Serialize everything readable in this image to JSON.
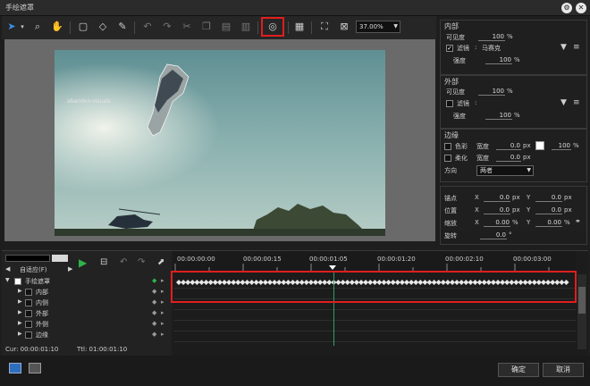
{
  "window": {
    "title": "手绘遮罩"
  },
  "toolbar": {
    "icons": [
      "arrow-cursor-icon",
      "zoom-icon",
      "hand-icon",
      "rectangle-icon",
      "ellipse-icon",
      "pen-icon",
      "undo-icon",
      "redo-icon",
      "cut-icon",
      "copy-icon",
      "paste-icon",
      "delete-icon",
      "track-object-icon",
      "grid-icon",
      "fit-icon",
      "fullscreen-icon"
    ],
    "zoom": "37.00%"
  },
  "preview": {
    "watermark": "abandon-visuals"
  },
  "inner": {
    "title": "内部",
    "visibility_label": "可见度",
    "visibility": "100",
    "filter_label": "滤镜",
    "filter_value": "马赛克",
    "strength_label": "强度",
    "strength": "100"
  },
  "outer": {
    "title": "外部",
    "visibility_label": "可见度",
    "visibility": "100",
    "filter_label": "滤镜",
    "filter_value": "",
    "strength_label": "强度",
    "strength": "100"
  },
  "edge": {
    "title": "边缘",
    "color_label": "色彩",
    "width_label": "宽度",
    "width": "0.0",
    "opacity": "100",
    "soften_label": "柔化",
    "soften_width": "0.0",
    "direction_label": "方向",
    "direction": "两者"
  },
  "transform": {
    "anchor_label": "锚点",
    "anchor_x": "0.0",
    "anchor_y": "0.0",
    "position_label": "位置",
    "pos_x": "0.0",
    "pos_y": "0.0",
    "scale_label": "缩放",
    "scale_x": "0.00",
    "scale_y": "0.00",
    "rotate_label": "旋转",
    "rotate": "0.0"
  },
  "units": {
    "percent": "%",
    "px": "px",
    "degree": "°"
  },
  "axis": {
    "x": "X",
    "y": "Y"
  },
  "timeline": {
    "fit_label": "自适应(F)",
    "ruler": [
      "00:00:00:00",
      "00:00:00:15",
      "00:00:01:05",
      "00:00:01:20",
      "00:00:02:10",
      "00:00:03:00"
    ],
    "layers": [
      "手绘遮罩",
      "内部",
      "内侧",
      "外部",
      "外侧",
      "边缘"
    ],
    "cur": "Cur: 00:00:01:10",
    "ttl": "Ttl: 01:00:01:10"
  },
  "footer": {
    "ok": "确定",
    "cancel": "取消"
  },
  "colors": {
    "highlight": "#e01e1e",
    "playhead": "#2aa06a"
  }
}
